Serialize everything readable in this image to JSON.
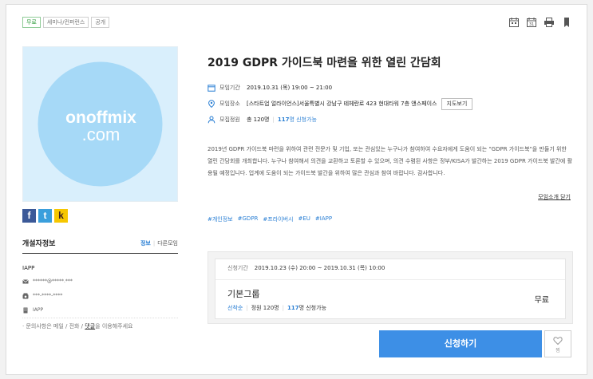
{
  "tags": [
    "무료",
    "세미나/컨퍼런스",
    "공개"
  ],
  "top_icons": [
    "calendar-icon",
    "calendar-31-icon",
    "print-icon",
    "bookmark-icon"
  ],
  "poster": {
    "logo_main": "onoffmix",
    "logo_sub": ".com",
    "bg_color": "#d9effc",
    "circle_color": "#a6d9f7"
  },
  "social": {
    "facebook": "f",
    "twitter": "t",
    "kakao": "k"
  },
  "host": {
    "title": "개설자정보",
    "link_info": "정보",
    "link_other": "다른모임",
    "name": "IAPP",
    "email": "******@*****.***",
    "phone": "***-****-****",
    "org": "IAPP",
    "note_prefix": "· 문의사항은 메일 / 전화 / ",
    "note_link": "댓글",
    "note_suffix": "을 이용해주세요"
  },
  "event": {
    "title": "2019 GDPR 가이드북 마련을 위한 열린 간담회",
    "period_label": "모임기간",
    "period_value": "2019.10.31 (목) 19:00 ~ 21:00",
    "place_label": "모임장소",
    "place_value": "[스타트업 얼라이언스]서울특별시 강남구 테헤란로 423 현대타워 7층 앤스페이스",
    "map_button": "지도보기",
    "capacity_label": "모집정원",
    "capacity_total": "총 120명",
    "capacity_avail_num": "117",
    "capacity_avail_text": "명 신청가능",
    "description": "2019년 GDPR 가이드북 마련을 위하여 관련 전문가 및 기업, 또는 관심있는 누구나가 참여하여 수요자에게 도움이 되는 \"GDPR 가이드북\"을 만들기 위한 열린 간담회를 개최합니다. 누구나 참여해서 의견을 교환하고 토론할 수 있으며, 의견 수렴된 사항은 정부/KISA가 발간하는 2019 GDPR 가이드북 발간에 활용될 예정입니다. 업계에 도움이 되는 가이드북 발간을 위하여 많은 관심과 참여 바랍니다. 감사합니다.",
    "collapse_link": "모임소개 닫기",
    "hashtags": [
      "#개인정보",
      "#GDPR",
      "#프라이버시",
      "#EU",
      "#IAPP"
    ]
  },
  "registration": {
    "period_label": "신청기간",
    "period_value": "2019.10.23 (수) 20:00 ~ 2019.10.31 (목) 10:00",
    "group_name": "기본그룹",
    "order": "선착순",
    "capacity": "정원 120명",
    "avail_num": "117",
    "avail_text": "명 신청가능",
    "price": "무료"
  },
  "actions": {
    "apply": "신청하기",
    "like": "찜"
  },
  "colors": {
    "accent": "#3d8fe6",
    "link": "#2a7fd4",
    "free_tag": "#2c9a3a"
  }
}
